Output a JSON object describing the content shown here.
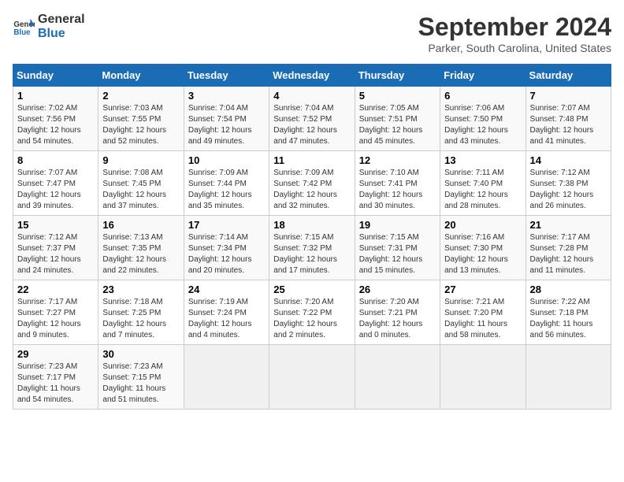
{
  "header": {
    "logo_line1": "General",
    "logo_line2": "Blue",
    "title": "September 2024",
    "subtitle": "Parker, South Carolina, United States"
  },
  "days_of_week": [
    "Sunday",
    "Monday",
    "Tuesday",
    "Wednesday",
    "Thursday",
    "Friday",
    "Saturday"
  ],
  "weeks": [
    [
      {
        "day": "1",
        "info": "Sunrise: 7:02 AM\nSunset: 7:56 PM\nDaylight: 12 hours\nand 54 minutes."
      },
      {
        "day": "2",
        "info": "Sunrise: 7:03 AM\nSunset: 7:55 PM\nDaylight: 12 hours\nand 52 minutes."
      },
      {
        "day": "3",
        "info": "Sunrise: 7:04 AM\nSunset: 7:54 PM\nDaylight: 12 hours\nand 49 minutes."
      },
      {
        "day": "4",
        "info": "Sunrise: 7:04 AM\nSunset: 7:52 PM\nDaylight: 12 hours\nand 47 minutes."
      },
      {
        "day": "5",
        "info": "Sunrise: 7:05 AM\nSunset: 7:51 PM\nDaylight: 12 hours\nand 45 minutes."
      },
      {
        "day": "6",
        "info": "Sunrise: 7:06 AM\nSunset: 7:50 PM\nDaylight: 12 hours\nand 43 minutes."
      },
      {
        "day": "7",
        "info": "Sunrise: 7:07 AM\nSunset: 7:48 PM\nDaylight: 12 hours\nand 41 minutes."
      }
    ],
    [
      {
        "day": "8",
        "info": "Sunrise: 7:07 AM\nSunset: 7:47 PM\nDaylight: 12 hours\nand 39 minutes."
      },
      {
        "day": "9",
        "info": "Sunrise: 7:08 AM\nSunset: 7:45 PM\nDaylight: 12 hours\nand 37 minutes."
      },
      {
        "day": "10",
        "info": "Sunrise: 7:09 AM\nSunset: 7:44 PM\nDaylight: 12 hours\nand 35 minutes."
      },
      {
        "day": "11",
        "info": "Sunrise: 7:09 AM\nSunset: 7:42 PM\nDaylight: 12 hours\nand 32 minutes."
      },
      {
        "day": "12",
        "info": "Sunrise: 7:10 AM\nSunset: 7:41 PM\nDaylight: 12 hours\nand 30 minutes."
      },
      {
        "day": "13",
        "info": "Sunrise: 7:11 AM\nSunset: 7:40 PM\nDaylight: 12 hours\nand 28 minutes."
      },
      {
        "day": "14",
        "info": "Sunrise: 7:12 AM\nSunset: 7:38 PM\nDaylight: 12 hours\nand 26 minutes."
      }
    ],
    [
      {
        "day": "15",
        "info": "Sunrise: 7:12 AM\nSunset: 7:37 PM\nDaylight: 12 hours\nand 24 minutes."
      },
      {
        "day": "16",
        "info": "Sunrise: 7:13 AM\nSunset: 7:35 PM\nDaylight: 12 hours\nand 22 minutes."
      },
      {
        "day": "17",
        "info": "Sunrise: 7:14 AM\nSunset: 7:34 PM\nDaylight: 12 hours\nand 20 minutes."
      },
      {
        "day": "18",
        "info": "Sunrise: 7:15 AM\nSunset: 7:32 PM\nDaylight: 12 hours\nand 17 minutes."
      },
      {
        "day": "19",
        "info": "Sunrise: 7:15 AM\nSunset: 7:31 PM\nDaylight: 12 hours\nand 15 minutes."
      },
      {
        "day": "20",
        "info": "Sunrise: 7:16 AM\nSunset: 7:30 PM\nDaylight: 12 hours\nand 13 minutes."
      },
      {
        "day": "21",
        "info": "Sunrise: 7:17 AM\nSunset: 7:28 PM\nDaylight: 12 hours\nand 11 minutes."
      }
    ],
    [
      {
        "day": "22",
        "info": "Sunrise: 7:17 AM\nSunset: 7:27 PM\nDaylight: 12 hours\nand 9 minutes."
      },
      {
        "day": "23",
        "info": "Sunrise: 7:18 AM\nSunset: 7:25 PM\nDaylight: 12 hours\nand 7 minutes."
      },
      {
        "day": "24",
        "info": "Sunrise: 7:19 AM\nSunset: 7:24 PM\nDaylight: 12 hours\nand 4 minutes."
      },
      {
        "day": "25",
        "info": "Sunrise: 7:20 AM\nSunset: 7:22 PM\nDaylight: 12 hours\nand 2 minutes."
      },
      {
        "day": "26",
        "info": "Sunrise: 7:20 AM\nSunset: 7:21 PM\nDaylight: 12 hours\nand 0 minutes."
      },
      {
        "day": "27",
        "info": "Sunrise: 7:21 AM\nSunset: 7:20 PM\nDaylight: 11 hours\nand 58 minutes."
      },
      {
        "day": "28",
        "info": "Sunrise: 7:22 AM\nSunset: 7:18 PM\nDaylight: 11 hours\nand 56 minutes."
      }
    ],
    [
      {
        "day": "29",
        "info": "Sunrise: 7:23 AM\nSunset: 7:17 PM\nDaylight: 11 hours\nand 54 minutes."
      },
      {
        "day": "30",
        "info": "Sunrise: 7:23 AM\nSunset: 7:15 PM\nDaylight: 11 hours\nand 51 minutes."
      },
      {
        "day": "",
        "info": ""
      },
      {
        "day": "",
        "info": ""
      },
      {
        "day": "",
        "info": ""
      },
      {
        "day": "",
        "info": ""
      },
      {
        "day": "",
        "info": ""
      }
    ]
  ]
}
